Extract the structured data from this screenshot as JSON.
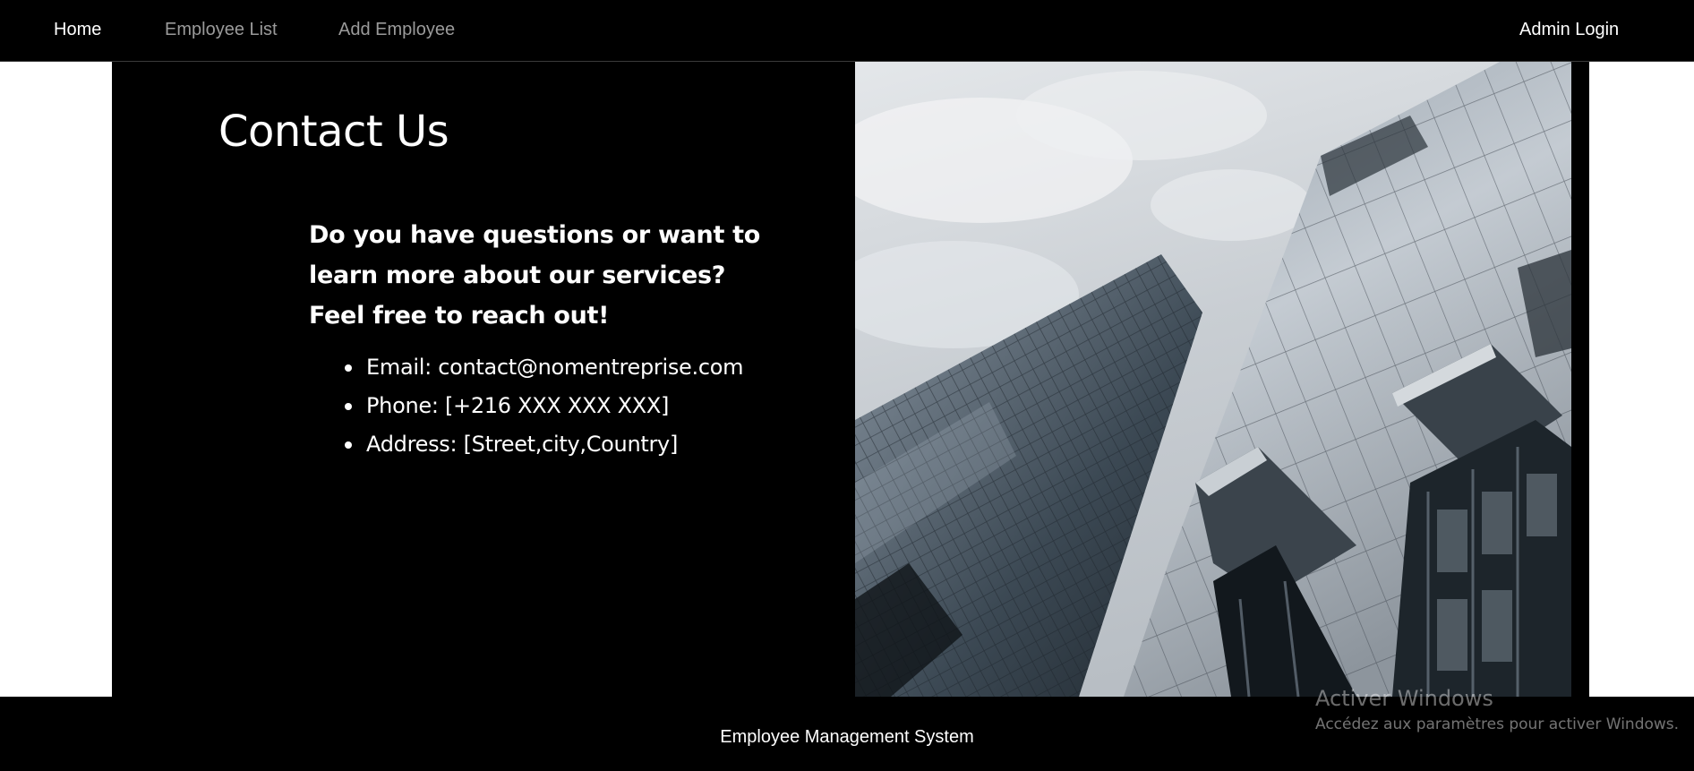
{
  "nav": {
    "home": "Home",
    "employee_list": "Employee List",
    "add_employee": "Add Employee",
    "admin_login": "Admin Login"
  },
  "contact": {
    "title": "Contact Us",
    "intro": "Do you have questions or want to learn more about our services? Feel free to reach out!",
    "items": [
      "Email: contact@nomentreprise.com",
      "Phone: [+216 XXX XXX XXX]",
      "Address: [Street,city,Country]"
    ]
  },
  "footer": {
    "text": "Employee Management System"
  },
  "watermark": {
    "title": "Activer Windows",
    "subtitle": "Accédez aux paramètres pour activer Windows."
  },
  "colors": {
    "background": "#000000",
    "page": "#ffffff",
    "nav_active": "#ffffff",
    "nav_inactive": "#9a9a9a"
  }
}
